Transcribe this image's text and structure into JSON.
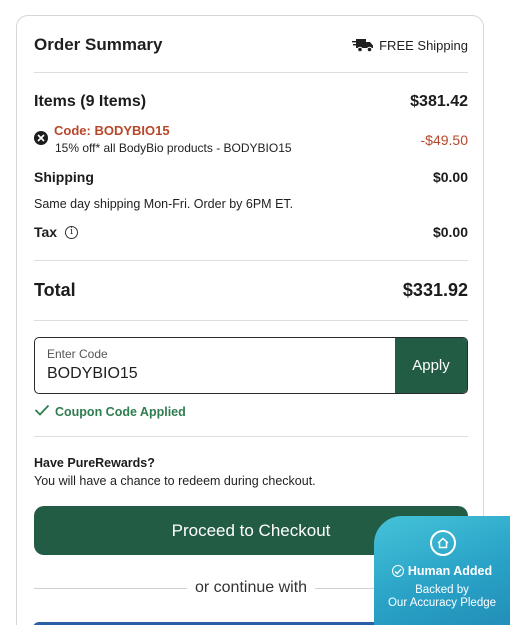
{
  "summary": {
    "title": "Order Summary",
    "shipping_badge": "FREE Shipping"
  },
  "items": {
    "label": "Items (9 Items)",
    "amount": "$381.42"
  },
  "coupon": {
    "code_label": "Code: BODYBIO15",
    "description": "15% off* all BodyBio products - BODYBIO15",
    "discount": "-$49.50"
  },
  "shipping": {
    "label": "Shipping",
    "amount": "$0.00",
    "note": "Same day shipping Mon-Fri. Order by 6PM ET."
  },
  "tax": {
    "label": "Tax",
    "amount": "$0.00"
  },
  "total": {
    "label": "Total",
    "amount": "$331.92"
  },
  "promo": {
    "field_label": "Enter Code",
    "value": "BODYBIO15",
    "apply_label": "Apply",
    "applied_message": "Coupon Code Applied"
  },
  "rewards": {
    "title": "Have PureRewards?",
    "text": "You will have a chance to redeem during checkout."
  },
  "checkout": {
    "button_label": "Proceed to Checkout",
    "alt_divider": "or continue with"
  },
  "badge": {
    "title": "Human Added",
    "line1": "Backed by",
    "line2": "Our Accuracy Pledge"
  },
  "colors": {
    "brand_green": "#235c44",
    "discount_red": "#b7472a",
    "success_green": "#2e7d4f",
    "badge_teal": "#2aa3c7"
  },
  "icons": [
    "truck-icon",
    "remove-coupon-icon",
    "info-icon",
    "check-icon",
    "home-chat-icon",
    "check-circle-icon"
  ]
}
